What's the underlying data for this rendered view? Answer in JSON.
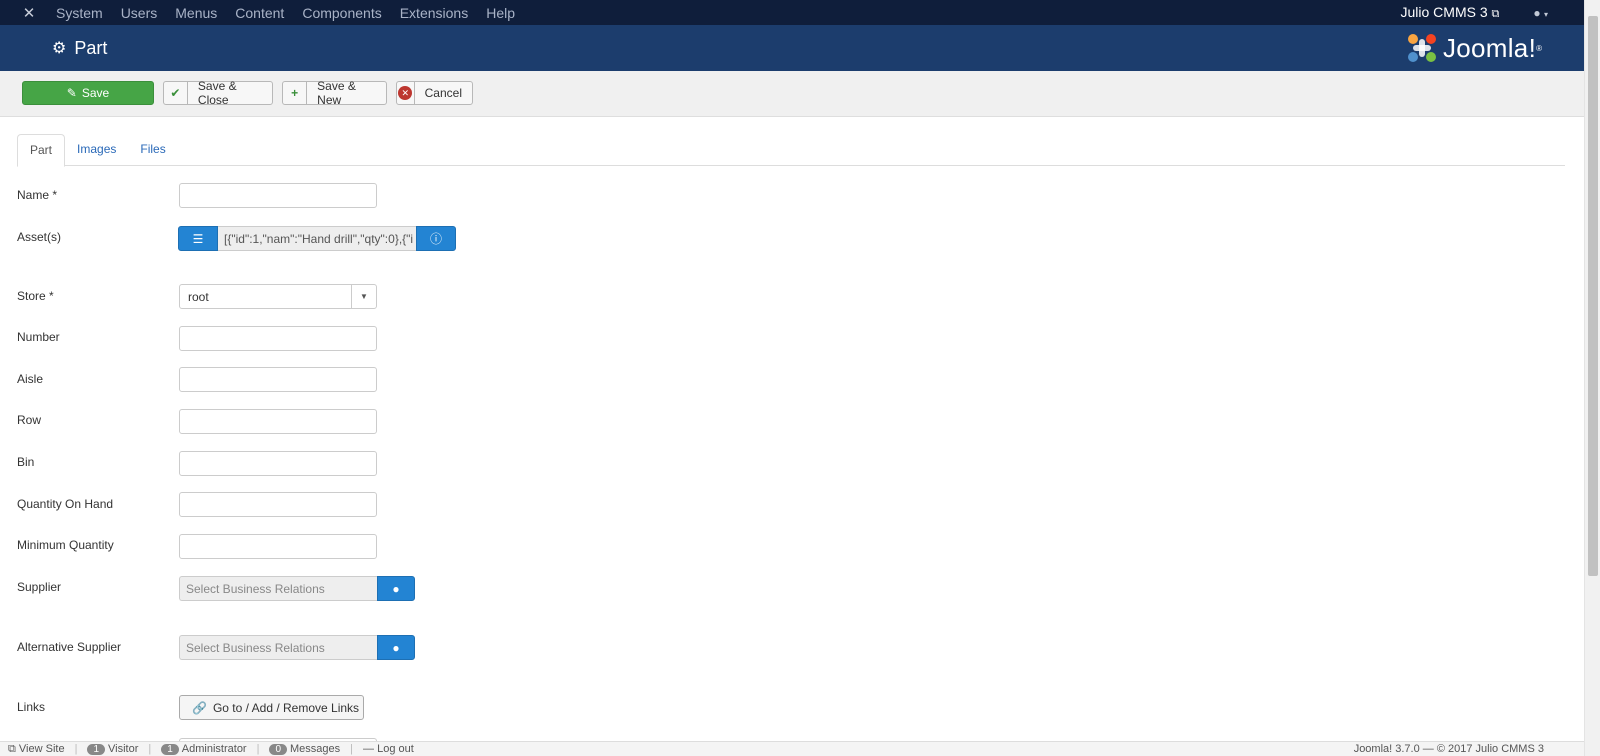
{
  "navbar": {
    "logo_icon": "joomla-icon",
    "menu": [
      "System",
      "Users",
      "Menus",
      "Content",
      "Components",
      "Extensions",
      "Help"
    ],
    "site_name": "Julio CMMS 3",
    "user_icon": "user-icon"
  },
  "header": {
    "title": "Part",
    "title_icon": "cogs-icon",
    "brand": "Joomla!"
  },
  "toolbar": {
    "save": "Save",
    "save_close": "Save & Close",
    "save_new": "Save & New",
    "cancel": "Cancel"
  },
  "tabs": [
    "Part",
    "Images",
    "Files"
  ],
  "active_tab": "Part",
  "form": {
    "name_label": "Name *",
    "assets_label": "Asset(s)",
    "assets_value": "[{\"id\":1,\"nam\":\"Hand drill\",\"qty\":0},{\"i",
    "store_label": "Store *",
    "store_value": "root",
    "number_label": "Number",
    "aisle_label": "Aisle",
    "row_label": "Row",
    "bin_label": "Bin",
    "qty_on_hand_label": "Quantity On Hand",
    "min_qty_label": "Minimum Quantity",
    "supplier_label": "Supplier",
    "supplier_placeholder": "Select Business Relations",
    "alt_supplier_label": "Alternative Supplier",
    "alt_supplier_placeholder": "Select Business Relations",
    "links_label": "Links",
    "links_button": "Go to / Add / Remove Links"
  },
  "statusbar": {
    "view_site": "View Site",
    "visitors_count": "1",
    "visitors_label": "Visitor",
    "admins_count": "1",
    "admins_label": "Administrator",
    "messages_count": "0",
    "messages_label": "Messages",
    "logout": "Log out",
    "version": "Joomla! 3.7.0 — © 2017 Julio CMMS 3"
  },
  "colors": {
    "navbar": "#0f1e3b",
    "header": "#1c3d6d",
    "save_button": "#46a546",
    "accent_blue": "#2384d3"
  }
}
